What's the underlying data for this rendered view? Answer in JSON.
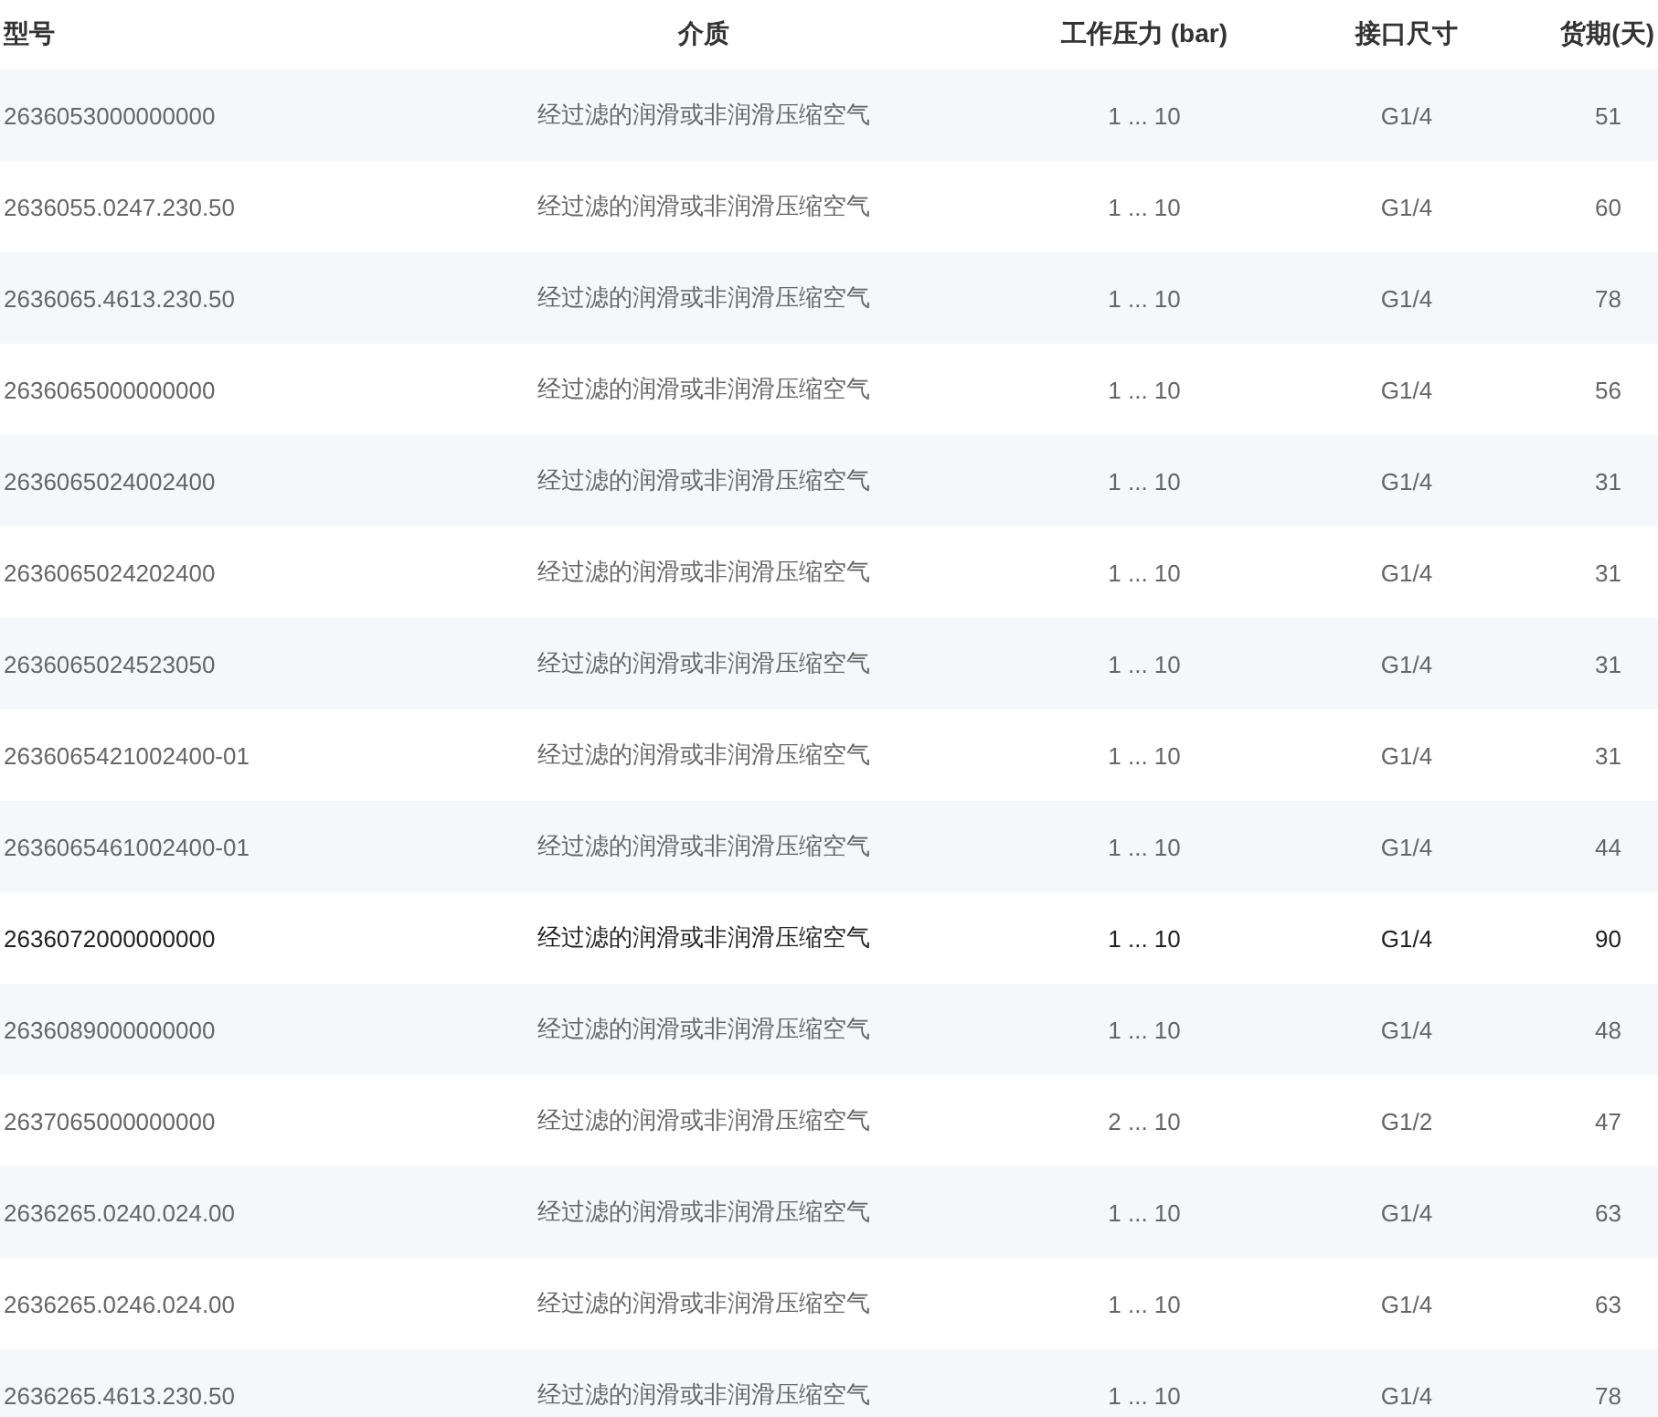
{
  "table": {
    "columns": [
      "型号",
      "介质",
      "工作压力 (bar)",
      "接口尺寸",
      "货期(天)"
    ],
    "rows": [
      {
        "cells": [
          "2636053000000000",
          "经过滤的润滑或非润滑压缩空气",
          "1 ... 10",
          "G1/4",
          "51"
        ],
        "hovered": false
      },
      {
        "cells": [
          "2636055.0247.230.50",
          "经过滤的润滑或非润滑压缩空气",
          "1 ... 10",
          "G1/4",
          "60"
        ],
        "hovered": false
      },
      {
        "cells": [
          "2636065.4613.230.50",
          "经过滤的润滑或非润滑压缩空气",
          "1 ... 10",
          "G1/4",
          "78"
        ],
        "hovered": false
      },
      {
        "cells": [
          "2636065000000000",
          "经过滤的润滑或非润滑压缩空气",
          "1 ... 10",
          "G1/4",
          "56"
        ],
        "hovered": false
      },
      {
        "cells": [
          "2636065024002400",
          "经过滤的润滑或非润滑压缩空气",
          "1 ... 10",
          "G1/4",
          "31"
        ],
        "hovered": false
      },
      {
        "cells": [
          "2636065024202400",
          "经过滤的润滑或非润滑压缩空气",
          "1 ... 10",
          "G1/4",
          "31"
        ],
        "hovered": false
      },
      {
        "cells": [
          "2636065024523050",
          "经过滤的润滑或非润滑压缩空气",
          "1 ... 10",
          "G1/4",
          "31"
        ],
        "hovered": false
      },
      {
        "cells": [
          "2636065421002400-01",
          "经过滤的润滑或非润滑压缩空气",
          "1 ... 10",
          "G1/4",
          "31"
        ],
        "hovered": false
      },
      {
        "cells": [
          "2636065461002400-01",
          "经过滤的润滑或非润滑压缩空气",
          "1 ... 10",
          "G1/4",
          "44"
        ],
        "hovered": false
      },
      {
        "cells": [
          "2636072000000000",
          "经过滤的润滑或非润滑压缩空气",
          "1 ... 10",
          "G1/4",
          "90"
        ],
        "hovered": true
      },
      {
        "cells": [
          "2636089000000000",
          "经过滤的润滑或非润滑压缩空气",
          "1 ... 10",
          "G1/4",
          "48"
        ],
        "hovered": false
      },
      {
        "cells": [
          "2637065000000000",
          "经过滤的润滑或非润滑压缩空气",
          "2 ... 10",
          "G1/2",
          "47"
        ],
        "hovered": false
      },
      {
        "cells": [
          "2636265.0240.024.00",
          "经过滤的润滑或非润滑压缩空气",
          "1 ... 10",
          "G1/4",
          "63"
        ],
        "hovered": false
      },
      {
        "cells": [
          "2636265.0246.024.00",
          "经过滤的润滑或非润滑压缩空气",
          "1 ... 10",
          "G1/4",
          "63"
        ],
        "hovered": false
      },
      {
        "cells": [
          "2636265.4613.230.50",
          "经过滤的润滑或非润滑压缩空气",
          "1 ... 10",
          "G1/4",
          "78"
        ],
        "hovered": false
      }
    ]
  }
}
